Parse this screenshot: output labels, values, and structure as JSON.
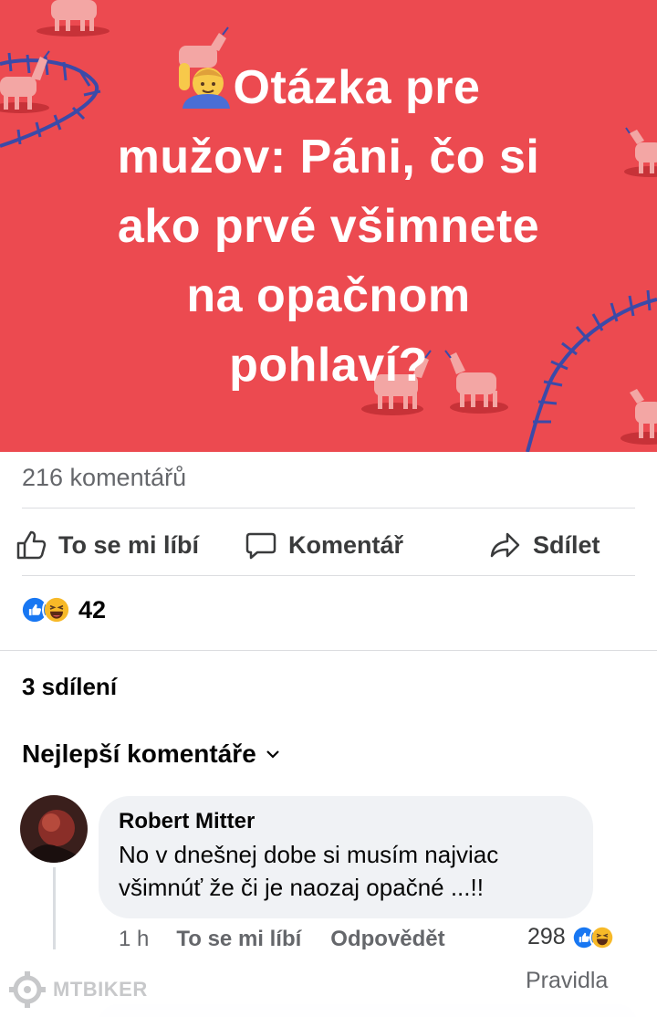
{
  "post": {
    "banner_title_lines": [
      "Otázka pre",
      "mužov: Páni, čo si",
      "ako prvé všimnete",
      "na opačnom",
      "pohlaví?"
    ],
    "banner_color": "#ec4a50",
    "emoji": "person-raising-hand-icon"
  },
  "stats": {
    "comments": "216 komentářů",
    "reaction_count": "42",
    "shares": "3 sdílení"
  },
  "actions": {
    "like": "To se mi líbí",
    "comment": "Komentář",
    "share": "Sdílet"
  },
  "comments_section": {
    "sort_label": "Nejlepší komentáře",
    "items": [
      {
        "author": "Robert Mitter",
        "text_line1": "No v dnešnej dobe si musím najviac",
        "text_line2": "všimnúť že či je naozaj opačné ...!!",
        "time": "1 h",
        "like": "To se mi líbí",
        "reply": "Odpovědět",
        "reaction_count": "298"
      }
    ]
  },
  "footer": {
    "watermark": "MTBIKER",
    "rules": "Pravidla"
  },
  "colors": {
    "like_blue": "#1877f2",
    "haha_yellow": "#f7b928",
    "muted_text": "#65676b"
  }
}
